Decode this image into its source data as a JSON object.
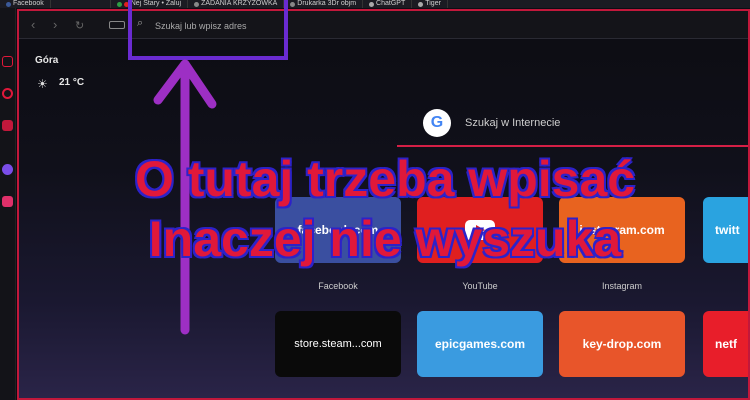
{
  "tabs": [
    {
      "label": "Facebook",
      "color": "#3b5998"
    },
    {
      "label": "",
      "color": "#333"
    },
    {
      "label": "Nej Stary • Zaluj",
      "color": "#2e9e44"
    },
    {
      "label": "ZADANIA KRZYZOWKA",
      "color": "#888"
    },
    {
      "label": "Drukarka 3Dr objm",
      "color": "#888"
    },
    {
      "label": "ChatGPT",
      "color": "#aaa"
    },
    {
      "label": "Tiger",
      "color": "#aaa"
    }
  ],
  "address_bar": {
    "placeholder": "Szukaj lub wpisz adres"
  },
  "weather": {
    "city": "Góra",
    "temp": "21 °C"
  },
  "search": {
    "label": "Szukaj w Internecie",
    "logo": "G"
  },
  "tiles": [
    {
      "label": "facebook.com",
      "caption": "Facebook",
      "bg": "#3a4fa0"
    },
    {
      "label": "",
      "caption": "YouTube",
      "bg": "#e01f1f"
    },
    {
      "label": "instagram.com",
      "caption": "Instagram",
      "bg": "#e8631f"
    },
    {
      "label": "twitt",
      "caption": "",
      "bg": "#2aa3e0"
    },
    {
      "label": "store.steam...com",
      "caption": "",
      "bg": "#0a0a0a"
    },
    {
      "label": "epicgames.com",
      "caption": "",
      "bg": "#3a9be0"
    },
    {
      "label": "key-drop.com",
      "caption": "",
      "bg": "#e8552a"
    },
    {
      "label": "netf",
      "caption": "",
      "bg": "#e81e2a"
    }
  ],
  "overlay": {
    "line1": "O tutaj trzeba wpisać",
    "line2": "Inaczej nie wyszuka"
  },
  "colors": {
    "accent": "#c2183b",
    "annotation": "#6a2bd1"
  }
}
